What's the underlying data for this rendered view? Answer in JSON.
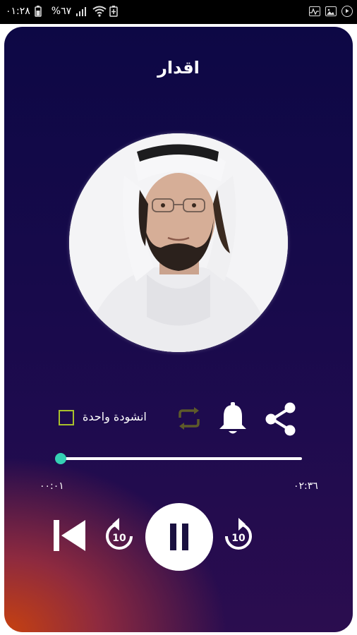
{
  "status_bar": {
    "time": "٠١:٢٨",
    "battery": "%٦٧",
    "icons_left": [
      "battery-icon",
      "signal-icon",
      "wifi-icon",
      "battery-saver-icon"
    ],
    "icons_right": [
      "activity-icon",
      "image-icon",
      "play-circle-icon"
    ]
  },
  "player": {
    "title": "اقدار",
    "artwork_icon": "artist-portrait",
    "single_track_label": "انشودة واحدة",
    "single_track_checked": false,
    "progress_fraction": 0.0,
    "current_time": "٠٠:٠١",
    "total_time": "٠٢:٣٦",
    "skip_seconds": "10",
    "colors": {
      "accent": "#35d0b3",
      "checkbox": "#a9c02c",
      "background_top": "#0d0845",
      "background_bottom_glow": "#c7410f"
    }
  }
}
